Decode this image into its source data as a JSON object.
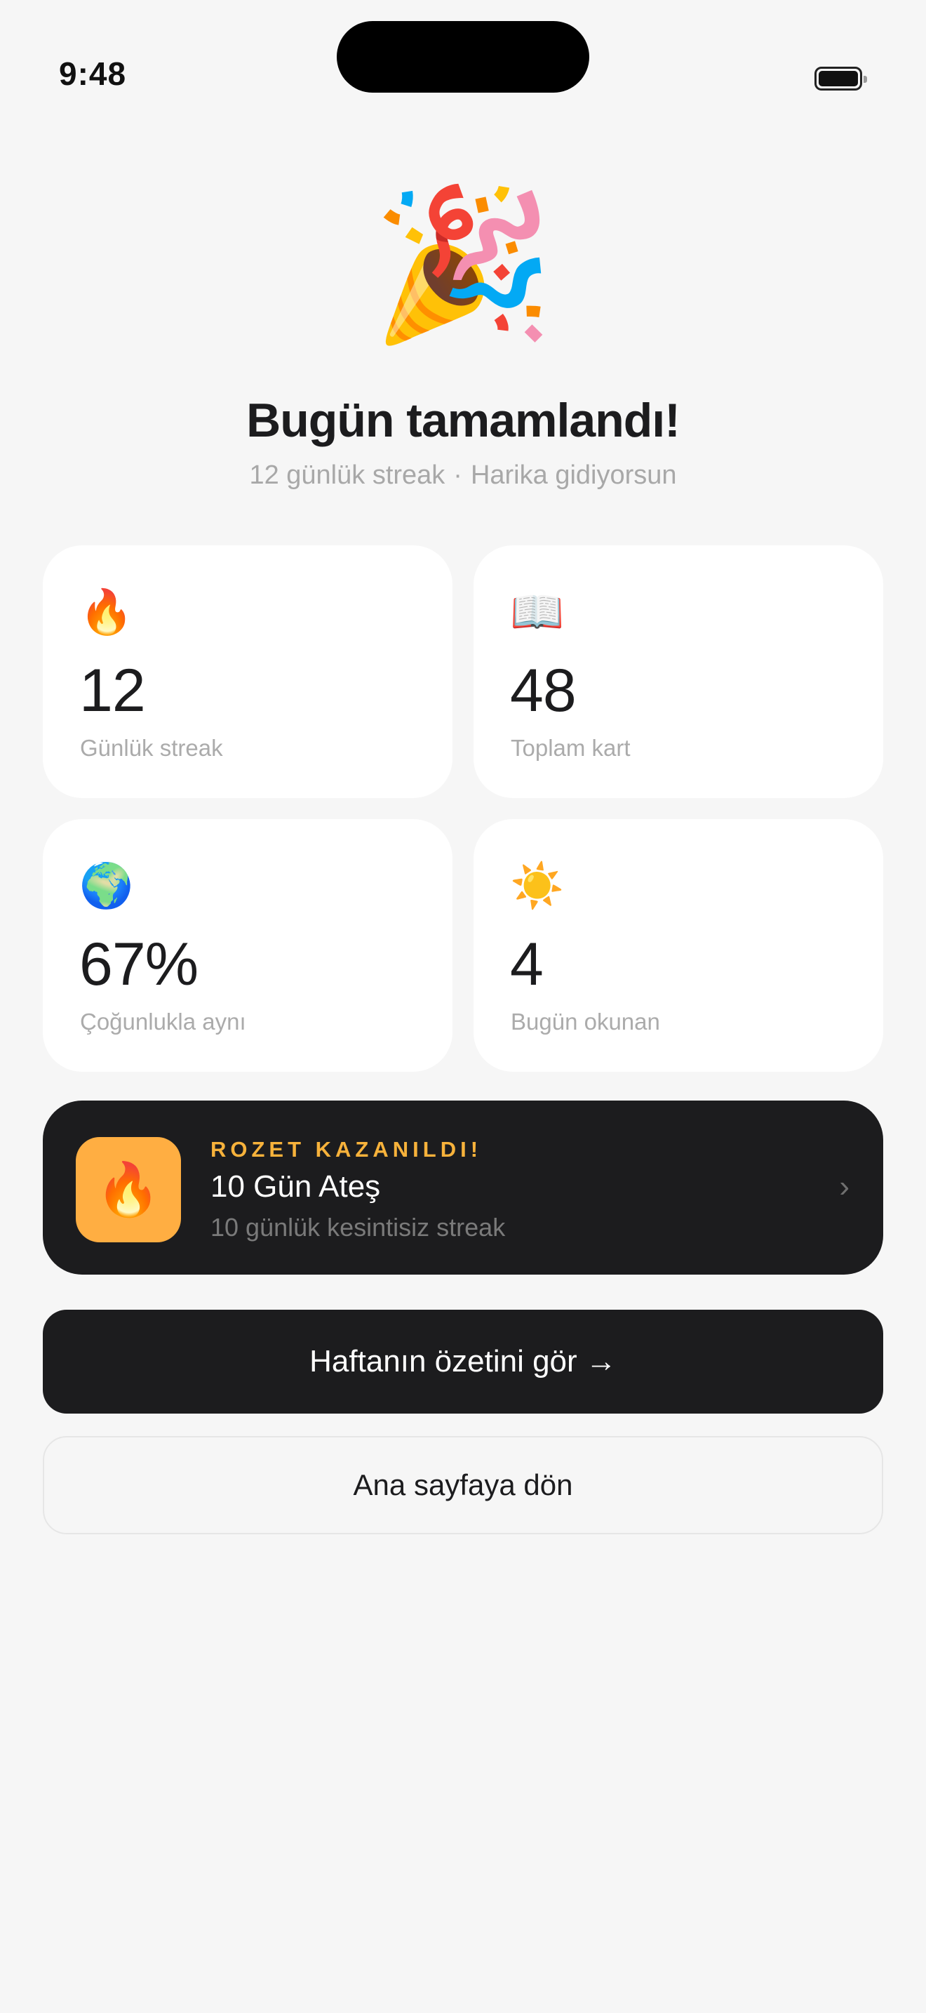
{
  "status_bar": {
    "time": "9:48"
  },
  "hero": {
    "emoji": "🎉",
    "title": "Bugün tamamlandı!",
    "subtitle_left": "12 günlük streak",
    "subtitle_sep": "·",
    "subtitle_right": "Harika gidiyorsun"
  },
  "stats": [
    {
      "icon": "🔥",
      "icon_name": "fire-icon",
      "value": "12",
      "label": "Günlük streak"
    },
    {
      "icon": "📖",
      "icon_name": "open-book-icon",
      "value": "48",
      "label": "Toplam kart"
    },
    {
      "icon": "🌍",
      "icon_name": "globe-icon",
      "value": "67%",
      "label": "Çoğunlukla aynı"
    },
    {
      "icon": "☀️",
      "icon_name": "sun-icon",
      "value": "4",
      "label": "Bugün okunan"
    }
  ],
  "badge": {
    "icon": "🔥",
    "kicker": "ROZET KAZANILDI!",
    "title": "10 Gün Ateş",
    "subtitle": "10 günlük kesintisiz streak",
    "chevron": "›"
  },
  "buttons": {
    "primary_label": "Haftanın özetini gör →",
    "secondary_label": "Ana sayfaya dön"
  },
  "colors": {
    "background": "#f6f6f6",
    "card": "#ffffff",
    "dark": "#1c1c1e",
    "badge_accent": "#f7b23b",
    "badge_icon_bg": "#ffae42"
  }
}
